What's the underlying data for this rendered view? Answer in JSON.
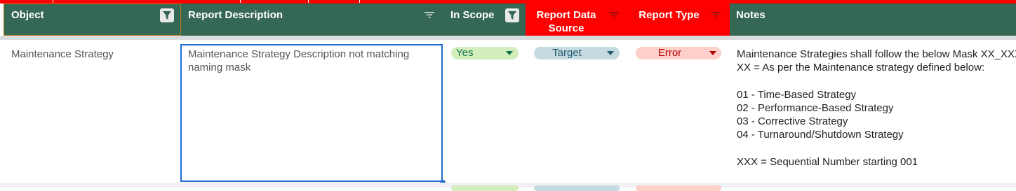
{
  "columns": {
    "object": "Object",
    "description": "Report Description",
    "in_scope": "In Scope",
    "data_source": "Report Data Source",
    "report_type": "Report Type",
    "notes": "Notes"
  },
  "row": {
    "object": "Maintenance Strategy",
    "description": "Maintenance Strategy Description not matching naming mask",
    "in_scope": "Yes",
    "data_source": "Target",
    "report_type": "Error",
    "notes": "Maintenance Strategies shall follow the below Mask XX_XXX where:\nXX = As per the Maintenance strategy defined below:\n\n01 - Time-Based Strategy\n02 - Performance-Based Strategy\n03 - Corrective Strategy\n04 - Turnaround/Shutdown Strategy\n\nXXX = Sequential Number starting 001"
  },
  "colors": {
    "header_green": "#356854",
    "header_red": "#ff0000",
    "chip_yes": "#d4edbc",
    "chip_target": "#c6dbe1",
    "chip_error": "#ffcfc9",
    "selection_blue": "#1f6fd1"
  }
}
